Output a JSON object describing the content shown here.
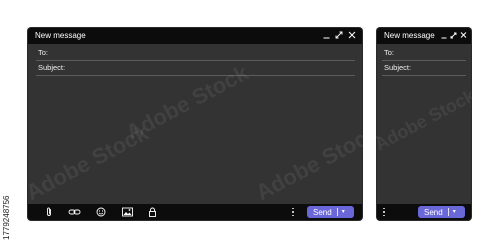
{
  "windows": {
    "large": {
      "title": "New message",
      "to_label": "To:",
      "subject_label": "Subject:",
      "send_label": "Send",
      "send_arrow": "▾"
    },
    "small": {
      "title": "New message",
      "to_label": "To:",
      "subject_label": "Subject:",
      "send_label": "Send",
      "send_arrow": "▾"
    }
  },
  "toolbar_icons": [
    "paperclip-icon",
    "link-icon",
    "emoji-icon",
    "image-icon",
    "lock-icon"
  ],
  "window_controls": [
    "minimize-icon",
    "expand-icon",
    "close-icon"
  ],
  "colors": {
    "titlebar": "#0c0c0c",
    "window_body": "#333333",
    "send_button": "#6a67d9",
    "text": "#ffffff"
  },
  "stock_id": "1779248756",
  "watermark_text": "Adobe Stock"
}
